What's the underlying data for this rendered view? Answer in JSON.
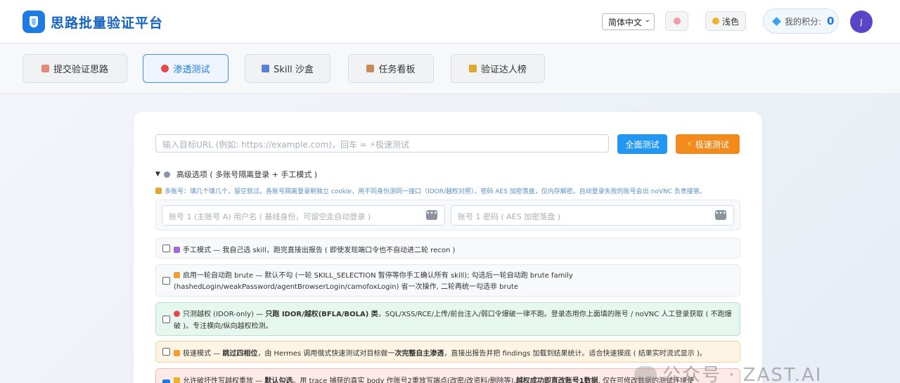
{
  "header": {
    "app_title": "思路批量验证平台",
    "language": "简体中文",
    "theme_label": "浅色",
    "points_label": "我的积分:",
    "points_value": "0",
    "avatar_initial": "J",
    "colors": {
      "brand": "#1e7be0",
      "avatar": "#5b45c6"
    }
  },
  "tabs": [
    {
      "label": "提交验证思路",
      "icon": "pencil-icon",
      "active": false
    },
    {
      "label": "渗透测试",
      "icon": "target-icon",
      "active": true
    },
    {
      "label": "Skill 沙盒",
      "icon": "grid-icon",
      "active": false
    },
    {
      "label": "任务看板",
      "icon": "clipboard-icon",
      "active": false
    },
    {
      "label": "验证达人榜",
      "icon": "trophy-icon",
      "active": false
    }
  ],
  "main": {
    "url_placeholder": "输入目标URL (例如: https://example.com)，回车 = ⚡极速测试",
    "full_test_label": "全面测试",
    "fast_test_label": "极速测试",
    "advanced_label": "高级选项 ( 多账号隔离登录 + 手工模式 )",
    "multi_account_hint": "多账号：填几个填几个，留空就过。各账号隔离登录刷独立 cookie，用不同身份测同一接口（IDOR/越权对照）。密码 AES 加密落盘，仅内存解密。自动登录失败的账号会出 noVNC 负责接管。",
    "account_username_placeholder": "账号 1 (主账号 A) 用户名 ( 基线身份，可留空走自动登录 )",
    "account_password_placeholder": "账号 1 密码 ( AES 加密落盘 )",
    "options": [
      {
        "text": "手工模式 — 我自己选 skill，跑完直接出报告 ( 即使发现端口令也不自动进二轮 recon )",
        "checked": false
      },
      {
        "text": "启用一轮自动跑 brute — 默认不勾 (一轮 SKILL_SELECTION 暂停等你手工确认所有 skill); 勾选后一轮自动跑 brute family (hashedLogin/weakPassword/agentBrowserLogin/camofoxLogin) 省一次操作, 二轮再统一勾选非 brute",
        "checked": false
      },
      {
        "prefix": "只测越权 (IDOR-only) — ",
        "bold": "只跑 IDOR/越权(BFLA/BOLA) 类",
        "suffix": "，SQL/XSS/RCE/上传/前台注入/弱口令爆破一律不跑。登录态用你上面填的账号 / noVNC 人工登录获取 ( 不跑爆破 )。专注横向/纵向越权检测。",
        "checked": false
      },
      {
        "prefix": "极速模式 — ",
        "bold": "跳过四相位",
        "middle": "，由 Hermes 调用俄式快速测试对目标做一",
        "bold2": "次完整自主渗透",
        "suffix": "，直接出报告并把 findings 加载到结果统计。适合快速摸底 ( 结果实时流式显示 )。",
        "checked": false
      },
      {
        "prefix": "允许破坏性写越权重放 — ",
        "bold": "默认勾选",
        "middle": "。用 trace 捕获的真实 body 作账号2重放写端点(改密/改资料/删除等),",
        "bold2": "越权成功即直改账号1数据",
        "suffix": ", 仅在可修改数据的测试环境使",
        "checked": true
      }
    ]
  },
  "watermark": "公众号 · ZAST.AI"
}
